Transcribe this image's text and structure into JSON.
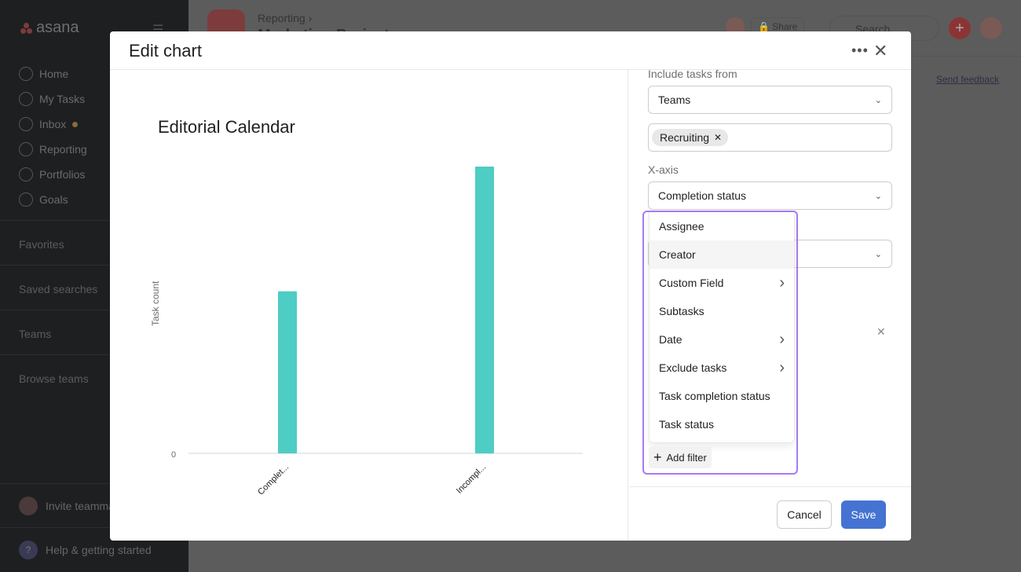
{
  "sidebar": {
    "logo": "asana",
    "items": [
      {
        "label": "Home"
      },
      {
        "label": "My Tasks"
      },
      {
        "label": "Inbox"
      },
      {
        "label": "Reporting"
      },
      {
        "label": "Portfolios"
      },
      {
        "label": "Goals"
      }
    ],
    "sections": [
      "Favorites",
      "Saved searches",
      "Teams",
      "Browse teams"
    ],
    "invite": "Invite teammates",
    "help": "Help & getting started"
  },
  "topbar": {
    "breadcrumb": "Reporting ›",
    "title": "Marketing Projects",
    "share": "Share",
    "search_placeholder": "Search",
    "feedback": "Send feedback"
  },
  "modal": {
    "title": "Edit chart",
    "include_label": "Include tasks from",
    "include_value": "Teams",
    "chip": "Recruiting",
    "xaxis_label": "X-axis",
    "xaxis_value": "Completion status",
    "filter_menu": [
      {
        "label": "Assignee",
        "submenu": false
      },
      {
        "label": "Creator",
        "submenu": false,
        "highlighted": true
      },
      {
        "label": "Custom Field",
        "submenu": true
      },
      {
        "label": "Subtasks",
        "submenu": false
      },
      {
        "label": "Date",
        "submenu": true
      },
      {
        "label": "Exclude tasks",
        "submenu": true
      },
      {
        "label": "Task completion status",
        "submenu": false
      },
      {
        "label": "Task status",
        "submenu": false
      }
    ],
    "add_filter": "Add filter",
    "cancel": "Cancel",
    "save": "Save"
  },
  "colors": {
    "bar": "#4ecdc4",
    "save": "#4573d2",
    "popup_border": "#a87af7"
  },
  "chart_data": {
    "type": "bar",
    "title": "Editorial Calendar",
    "ylabel": "Task count",
    "xlabel": "",
    "categories": [
      "Complet...",
      "Incompl..."
    ],
    "values": [
      13,
      23
    ],
    "yticks": [
      "0"
    ],
    "grid": false
  }
}
